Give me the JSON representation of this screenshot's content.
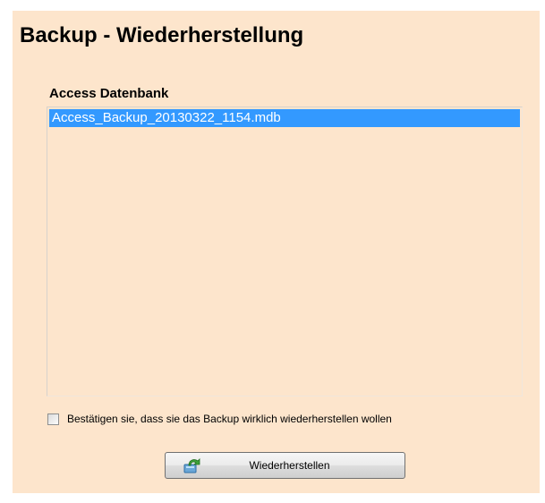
{
  "page": {
    "title": "Backup - Wiederherstellung",
    "background_color": "#fde5cc"
  },
  "database_section": {
    "label": "Access Datenbank",
    "items": [
      {
        "label": "Access_Backup_20130322_1154.mdb",
        "selected": true
      }
    ],
    "selection_color": "#3399ff"
  },
  "confirm": {
    "label": "Bestätigen sie, dass sie das Backup wirklich wiederherstellen wollen",
    "checked": false
  },
  "restore_button": {
    "label": "Wiederherstellen",
    "icon": "restore-arrow-icon"
  }
}
